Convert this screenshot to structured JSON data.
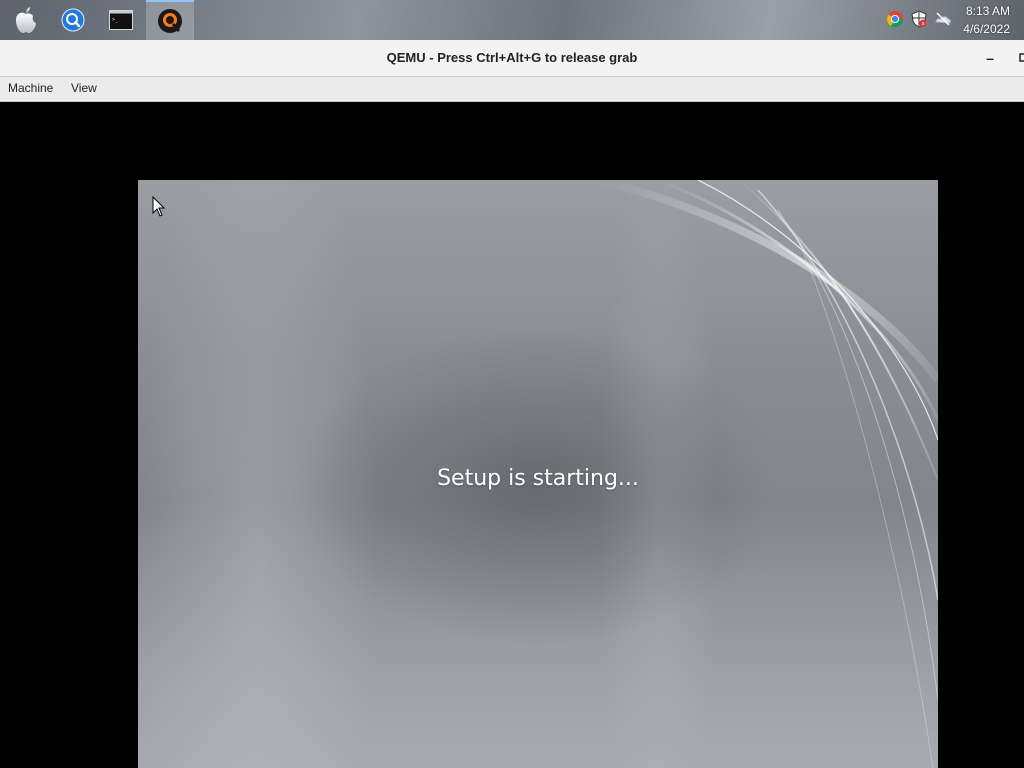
{
  "taskbar": {
    "apps": [
      {
        "icon": "apple-icon"
      },
      {
        "icon": "search-icon"
      },
      {
        "icon": "terminal-icon"
      },
      {
        "icon": "qemu-icon",
        "active": true
      }
    ],
    "tray": {
      "icons": [
        "chrome-icon",
        "security-shield-icon",
        "network-disconnected-icon"
      ],
      "time": "8:13 AM",
      "date": "4/6/2022"
    }
  },
  "window": {
    "title": "QEMU - Press Ctrl+Alt+G to release grab",
    "minimize_label": "–"
  },
  "menu": {
    "items": [
      "Machine",
      "View"
    ]
  },
  "guest": {
    "status_text": "Setup is starting..."
  },
  "colors": {
    "titlebar_bg": "#f3f3f3",
    "menubar_bg": "#ececec",
    "vm_bg": "#000000",
    "taskbar_active_accent": "#8ec6ff"
  }
}
